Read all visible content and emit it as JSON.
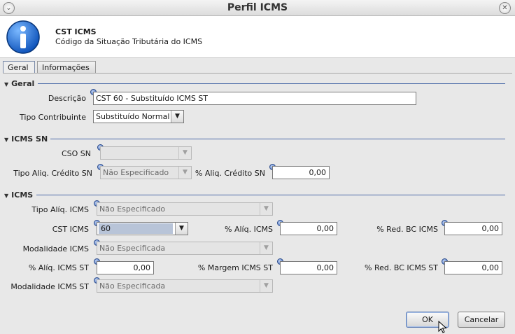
{
  "window": {
    "title": "Perfil ICMS",
    "close_icon": "close-icon",
    "expand_icon": "chevron-down-icon"
  },
  "header": {
    "title": "CST ICMS",
    "subtitle": "Código da Situação Tributária do ICMS",
    "icon": "info-icon"
  },
  "tabs": [
    {
      "label": "Geral",
      "active": true
    },
    {
      "label": "Informações",
      "active": false
    }
  ],
  "geral": {
    "heading": "Geral",
    "descricao_label": "Descrição",
    "descricao_value": "CST 60 - Substituído ICMS ST",
    "tipo_contribuinte_label": "Tipo Contribuinte",
    "tipo_contribuinte_value": "Substituído Normal"
  },
  "icms_sn": {
    "heading": "ICMS SN",
    "cso_label": "CSO SN",
    "cso_value": "",
    "tipo_aliq_label": "Tipo Aliq. Crédito SN",
    "tipo_aliq_value": "Não Especificado",
    "perc_aliq_label": "% Aliq. Crédito SN",
    "perc_aliq_value": "0,00"
  },
  "icms": {
    "heading": "ICMS",
    "tipo_aliq_label": "Tipo Alíq. ICMS",
    "tipo_aliq_value": "Não Especificado",
    "cst_label": "CST ICMS",
    "cst_value": "60",
    "aliq_icms_label": "% Alíq. ICMS",
    "aliq_icms_value": "0,00",
    "red_bc_label": "% Red. BC ICMS",
    "red_bc_value": "0,00",
    "modalidade_label": "Modalidade ICMS",
    "modalidade_value": "Não Especificada",
    "aliq_st_label": "% Alíq. ICMS ST",
    "aliq_st_value": "0,00",
    "margem_st_label": "% Margem ICMS ST",
    "margem_st_value": "0,00",
    "red_bc_st_label": "% Red. BC ICMS ST",
    "red_bc_st_value": "0,00",
    "modalidade_st_label": "Modalidade ICMS ST",
    "modalidade_st_value": "Não Especificada"
  },
  "buttons": {
    "ok": "OK",
    "cancel": "Cancelar"
  },
  "colors": {
    "section_line": "#4a6aa8",
    "hint": "#3e66b4",
    "info_icon": "#1f6fd6"
  }
}
